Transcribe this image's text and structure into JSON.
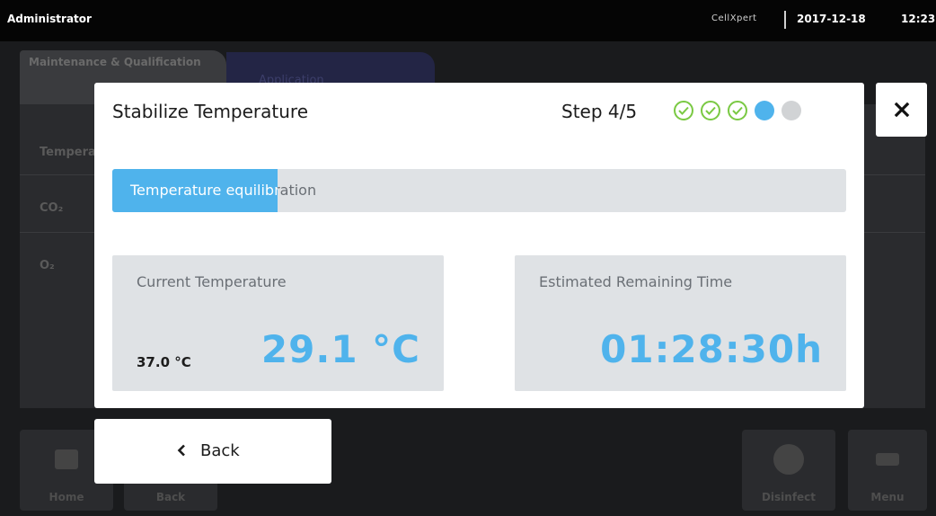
{
  "statusbar": {
    "user": "Administrator",
    "device": "CellXpert",
    "date": "2017-12-18",
    "time": "12:23"
  },
  "background_app": {
    "tabs": [
      "Maintenance & Qualification",
      "Application"
    ],
    "rows": [
      "Temperature",
      "CO₂",
      "O₂"
    ],
    "footer": [
      "Home",
      "Back",
      "Disinfect",
      "Menu"
    ]
  },
  "dialog": {
    "title": "Stabilize Temperature",
    "step_label": "Step 4/5",
    "steps": [
      "done",
      "done",
      "done",
      "active",
      "pending"
    ],
    "progress": {
      "label": "Temperature equilibration",
      "fraction": 0.225
    },
    "current_temp_card": {
      "label": "Current Temperature",
      "setpoint": "37.0 °C",
      "value": "29.1 °C"
    },
    "remaining_time_card": {
      "label": "Estimated Remaining Time",
      "value": "01:28:30h"
    }
  },
  "buttons": {
    "close": "×",
    "back": "Back"
  },
  "colors": {
    "accent": "#4fb3ec",
    "done": "#7ac943",
    "pending": "#d1d3d5",
    "card_bg": "#dfe2e5"
  }
}
